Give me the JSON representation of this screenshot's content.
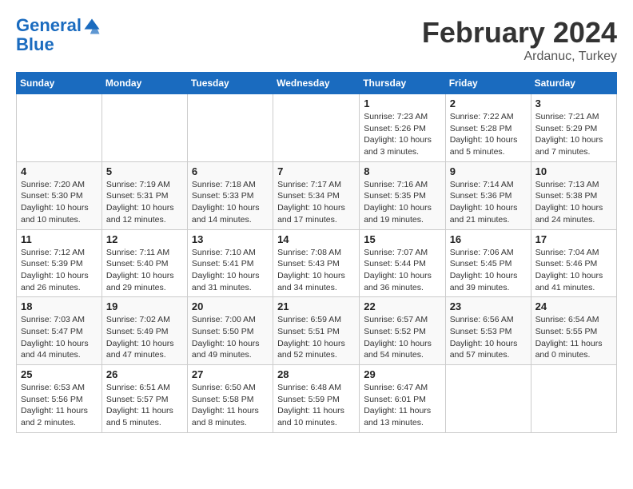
{
  "header": {
    "logo_line1": "General",
    "logo_line2": "Blue",
    "month": "February 2024",
    "location": "Ardanuc, Turkey"
  },
  "weekdays": [
    "Sunday",
    "Monday",
    "Tuesday",
    "Wednesday",
    "Thursday",
    "Friday",
    "Saturday"
  ],
  "weeks": [
    [
      {
        "day": "",
        "info": ""
      },
      {
        "day": "",
        "info": ""
      },
      {
        "day": "",
        "info": ""
      },
      {
        "day": "",
        "info": ""
      },
      {
        "day": "1",
        "info": "Sunrise: 7:23 AM\nSunset: 5:26 PM\nDaylight: 10 hours\nand 3 minutes."
      },
      {
        "day": "2",
        "info": "Sunrise: 7:22 AM\nSunset: 5:28 PM\nDaylight: 10 hours\nand 5 minutes."
      },
      {
        "day": "3",
        "info": "Sunrise: 7:21 AM\nSunset: 5:29 PM\nDaylight: 10 hours\nand 7 minutes."
      }
    ],
    [
      {
        "day": "4",
        "info": "Sunrise: 7:20 AM\nSunset: 5:30 PM\nDaylight: 10 hours\nand 10 minutes."
      },
      {
        "day": "5",
        "info": "Sunrise: 7:19 AM\nSunset: 5:31 PM\nDaylight: 10 hours\nand 12 minutes."
      },
      {
        "day": "6",
        "info": "Sunrise: 7:18 AM\nSunset: 5:33 PM\nDaylight: 10 hours\nand 14 minutes."
      },
      {
        "day": "7",
        "info": "Sunrise: 7:17 AM\nSunset: 5:34 PM\nDaylight: 10 hours\nand 17 minutes."
      },
      {
        "day": "8",
        "info": "Sunrise: 7:16 AM\nSunset: 5:35 PM\nDaylight: 10 hours\nand 19 minutes."
      },
      {
        "day": "9",
        "info": "Sunrise: 7:14 AM\nSunset: 5:36 PM\nDaylight: 10 hours\nand 21 minutes."
      },
      {
        "day": "10",
        "info": "Sunrise: 7:13 AM\nSunset: 5:38 PM\nDaylight: 10 hours\nand 24 minutes."
      }
    ],
    [
      {
        "day": "11",
        "info": "Sunrise: 7:12 AM\nSunset: 5:39 PM\nDaylight: 10 hours\nand 26 minutes."
      },
      {
        "day": "12",
        "info": "Sunrise: 7:11 AM\nSunset: 5:40 PM\nDaylight: 10 hours\nand 29 minutes."
      },
      {
        "day": "13",
        "info": "Sunrise: 7:10 AM\nSunset: 5:41 PM\nDaylight: 10 hours\nand 31 minutes."
      },
      {
        "day": "14",
        "info": "Sunrise: 7:08 AM\nSunset: 5:43 PM\nDaylight: 10 hours\nand 34 minutes."
      },
      {
        "day": "15",
        "info": "Sunrise: 7:07 AM\nSunset: 5:44 PM\nDaylight: 10 hours\nand 36 minutes."
      },
      {
        "day": "16",
        "info": "Sunrise: 7:06 AM\nSunset: 5:45 PM\nDaylight: 10 hours\nand 39 minutes."
      },
      {
        "day": "17",
        "info": "Sunrise: 7:04 AM\nSunset: 5:46 PM\nDaylight: 10 hours\nand 41 minutes."
      }
    ],
    [
      {
        "day": "18",
        "info": "Sunrise: 7:03 AM\nSunset: 5:47 PM\nDaylight: 10 hours\nand 44 minutes."
      },
      {
        "day": "19",
        "info": "Sunrise: 7:02 AM\nSunset: 5:49 PM\nDaylight: 10 hours\nand 47 minutes."
      },
      {
        "day": "20",
        "info": "Sunrise: 7:00 AM\nSunset: 5:50 PM\nDaylight: 10 hours\nand 49 minutes."
      },
      {
        "day": "21",
        "info": "Sunrise: 6:59 AM\nSunset: 5:51 PM\nDaylight: 10 hours\nand 52 minutes."
      },
      {
        "day": "22",
        "info": "Sunrise: 6:57 AM\nSunset: 5:52 PM\nDaylight: 10 hours\nand 54 minutes."
      },
      {
        "day": "23",
        "info": "Sunrise: 6:56 AM\nSunset: 5:53 PM\nDaylight: 10 hours\nand 57 minutes."
      },
      {
        "day": "24",
        "info": "Sunrise: 6:54 AM\nSunset: 5:55 PM\nDaylight: 11 hours\nand 0 minutes."
      }
    ],
    [
      {
        "day": "25",
        "info": "Sunrise: 6:53 AM\nSunset: 5:56 PM\nDaylight: 11 hours\nand 2 minutes."
      },
      {
        "day": "26",
        "info": "Sunrise: 6:51 AM\nSunset: 5:57 PM\nDaylight: 11 hours\nand 5 minutes."
      },
      {
        "day": "27",
        "info": "Sunrise: 6:50 AM\nSunset: 5:58 PM\nDaylight: 11 hours\nand 8 minutes."
      },
      {
        "day": "28",
        "info": "Sunrise: 6:48 AM\nSunset: 5:59 PM\nDaylight: 11 hours\nand 10 minutes."
      },
      {
        "day": "29",
        "info": "Sunrise: 6:47 AM\nSunset: 6:01 PM\nDaylight: 11 hours\nand 13 minutes."
      },
      {
        "day": "",
        "info": ""
      },
      {
        "day": "",
        "info": ""
      }
    ]
  ]
}
